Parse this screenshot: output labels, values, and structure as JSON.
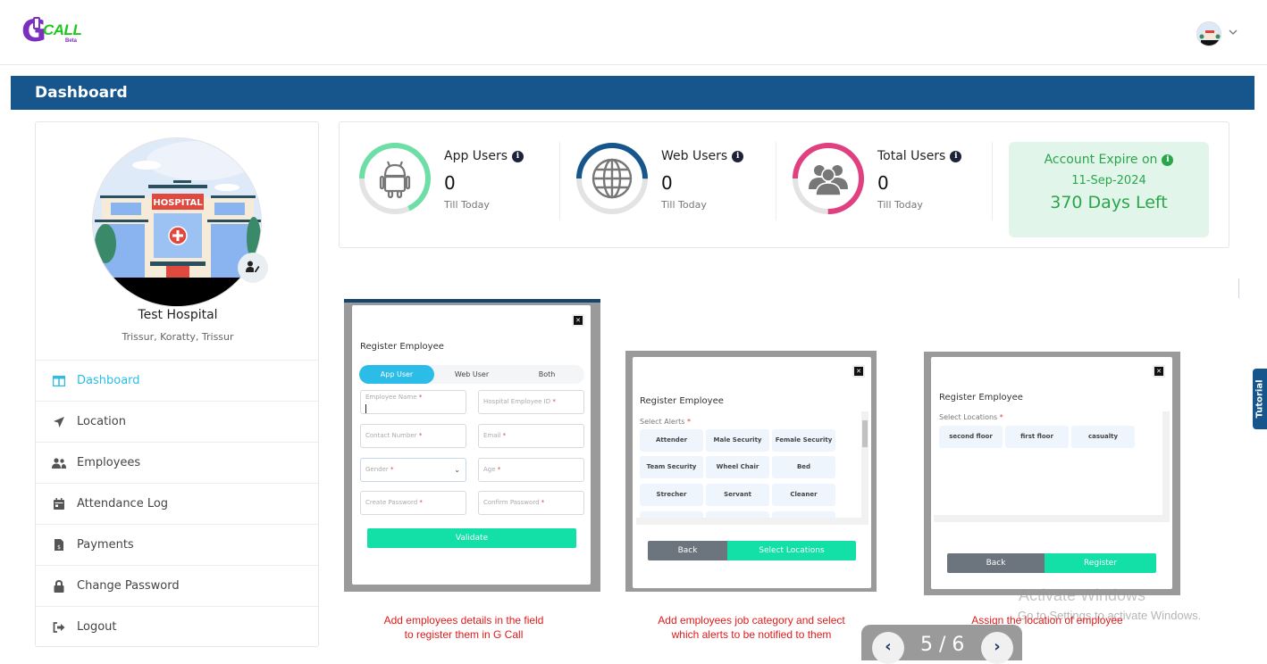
{
  "header": {
    "logo": {
      "letter": "G",
      "word": "CALL",
      "badge": "Beta"
    },
    "user_menu_icon": "chevron-down-icon"
  },
  "titlebar": {
    "title": "Dashboard"
  },
  "profile": {
    "name": "Test Hospital",
    "location": "Trissur, Koratty, Trissur",
    "image_sign": "HOSPITAL",
    "edit_icon": "user-edit-icon"
  },
  "sidebar": {
    "items": [
      {
        "label": "Dashboard",
        "icon": "dashboard-columns-icon",
        "active": true
      },
      {
        "label": "Location",
        "icon": "location-arrow-icon",
        "active": false
      },
      {
        "label": "Employees",
        "icon": "users-icon",
        "active": false
      },
      {
        "label": "Attendance Log",
        "icon": "calendar-icon",
        "active": false
      },
      {
        "label": "Payments",
        "icon": "invoice-dollar-icon",
        "active": false
      },
      {
        "label": "Change Password",
        "icon": "lock-icon",
        "active": false
      },
      {
        "label": "Logout",
        "icon": "sign-out-icon",
        "active": false
      }
    ]
  },
  "stats": [
    {
      "label": "App Users",
      "value": "0",
      "sub": "Till Today",
      "icon": "android-icon",
      "ring_color": "#6ddea6",
      "ring_fraction": 0.68
    },
    {
      "label": "Web Users",
      "value": "0",
      "sub": "Till Today",
      "icon": "globe-icon",
      "ring_color": "#16568c",
      "ring_fraction": 0.5
    },
    {
      "label": "Total Users",
      "value": "0",
      "sub": "Till Today",
      "icon": "users-group-icon",
      "ring_color": "#e0407f",
      "ring_fraction": 0.75
    }
  ],
  "account": {
    "title": "Account Expire on",
    "date": "11-Sep-2024",
    "days_left": "370 Days Left",
    "color": "#2aa64a"
  },
  "tutorial": {
    "tab_label": "Tutorial",
    "page": "5 / 6",
    "prev_icon": "chevron-left-icon",
    "next_icon": "chevron-right-icon",
    "slides": [
      {
        "caption_line1": "Add employees details in the field",
        "caption_line2": "to register them in G Call",
        "modal_title": "Register Employee",
        "segments": [
          "App User",
          "Web User",
          "Both"
        ],
        "fields": [
          {
            "label": "Employee Name",
            "value": ""
          },
          {
            "label": "Hospital Employee ID"
          },
          {
            "label": "Contact Number"
          },
          {
            "label": "Email"
          },
          {
            "label": "Gender"
          },
          {
            "label": "Age"
          },
          {
            "label": "Create Password"
          },
          {
            "label": "Confirm Password"
          }
        ],
        "required_mark": "*",
        "button": "Validate"
      },
      {
        "caption_line1": "Add employees job category and select",
        "caption_line2": "which alerts to be notified to them",
        "modal_title": "Register Employee",
        "section_label": "Select Alerts",
        "chips": [
          "Attender",
          "Male Security",
          "Female Security",
          "Team Security",
          "Wheel Chair",
          "Bed",
          "Strecher",
          "Servant",
          "Cleaner"
        ],
        "back_button": "Back",
        "next_button": "Select Locations"
      },
      {
        "caption": "Assign the location of employee",
        "modal_title": "Register Employee",
        "section_label": "Select Locations",
        "chips": [
          "second floor",
          "first floor",
          "casualty"
        ],
        "back_button": "Back",
        "next_button": "Register"
      }
    ]
  },
  "watermark": {
    "line1": "Activate Windows",
    "line2": "Go to Settings to activate Windows."
  }
}
